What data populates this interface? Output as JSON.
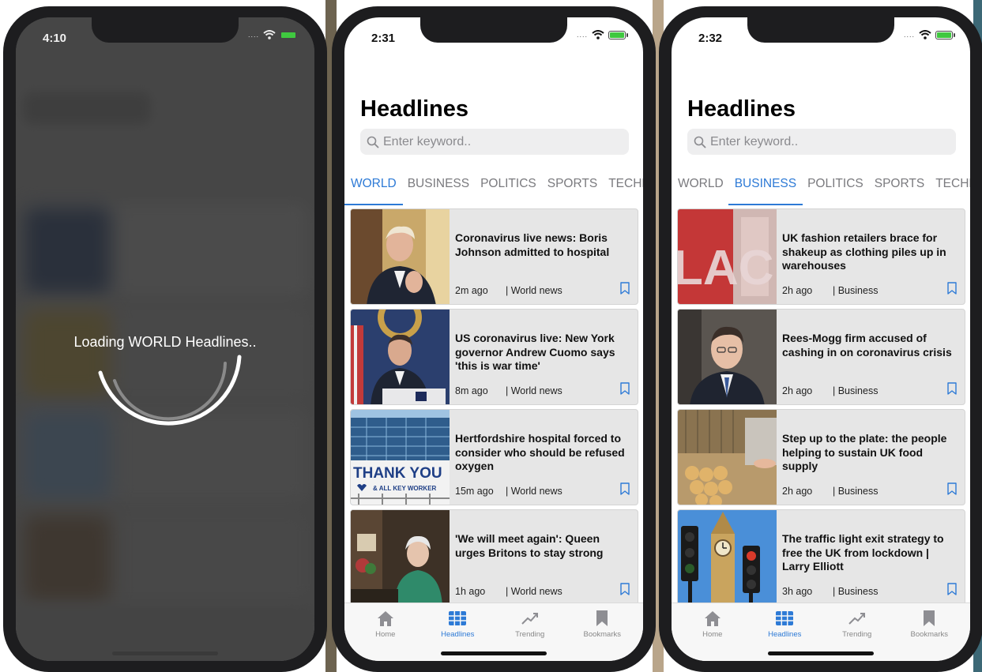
{
  "colors": {
    "accent": "#2d7ad6",
    "card_bg": "#e6e6e6",
    "tab_inactive": "#7a7a7e"
  },
  "loading_phone": {
    "time": "4:10",
    "status_dots": "....",
    "loading_text": "Loading WORLD Headlines.."
  },
  "world_phone": {
    "time": "2:31",
    "status_dots": "....",
    "title": "Headlines",
    "search_placeholder": "Enter keyword..",
    "tabs": [
      "WORLD",
      "BUSINESS",
      "POLITICS",
      "SPORTS",
      "TECHNO"
    ],
    "active_tab": "WORLD",
    "articles": [
      {
        "title": "Coronavirus live news: Boris Johnson admitted to hospital",
        "time": "2m ago",
        "source": "| World news",
        "thumb": "politician-photo"
      },
      {
        "title": "US coronavirus live: New York governor Andrew Cuomo says 'this is war time'",
        "time": "8m ago",
        "source": "| World news",
        "thumb": "press-conference-photo"
      },
      {
        "title": "Hertfordshire hospital forced to consider who should be refused oxygen",
        "time": "15m ago",
        "source": "| World news",
        "thumb": "hospital-banner-photo",
        "thumb_text": [
          "THANK YOU",
          "& ALL KEY WORKER"
        ]
      },
      {
        "title": "'We will meet again': Queen urges Britons to stay strong",
        "time": "1h ago",
        "source": "| World news",
        "thumb": "queen-address-photo"
      }
    ],
    "tabbar": [
      "Home",
      "Headlines",
      "Trending",
      "Bookmarks"
    ],
    "active_tabbar": "Headlines"
  },
  "business_phone": {
    "time": "2:32",
    "status_dots": "....",
    "title": "Headlines",
    "search_placeholder": "Enter keyword..",
    "tabs": [
      "WORLD",
      "BUSINESS",
      "POLITICS",
      "SPORTS",
      "TECHNO"
    ],
    "active_tab": "BUSINESS",
    "articles": [
      {
        "title": "UK fashion retailers brace for shakeup as clothing piles up in warehouses",
        "time": "2h ago",
        "source": "| Business",
        "thumb": "shop-window-photo",
        "thumb_text": [
          "LAC"
        ]
      },
      {
        "title": "Rees-Mogg firm accused of cashing in on coronavirus crisis",
        "time": "2h ago",
        "source": "| Business",
        "thumb": "portrait-photo"
      },
      {
        "title": "Step up to the plate: the people helping to sustain UK food supply",
        "time": "2h ago",
        "source": "| Business",
        "thumb": "bakery-photo"
      },
      {
        "title": "The traffic light exit strategy to free the UK from lockdown | Larry Elliott",
        "time": "3h ago",
        "source": "| Business",
        "thumb": "traffic-light-photo"
      }
    ],
    "tabbar": [
      "Home",
      "Headlines",
      "Trending",
      "Bookmarks"
    ],
    "active_tabbar": "Headlines"
  }
}
